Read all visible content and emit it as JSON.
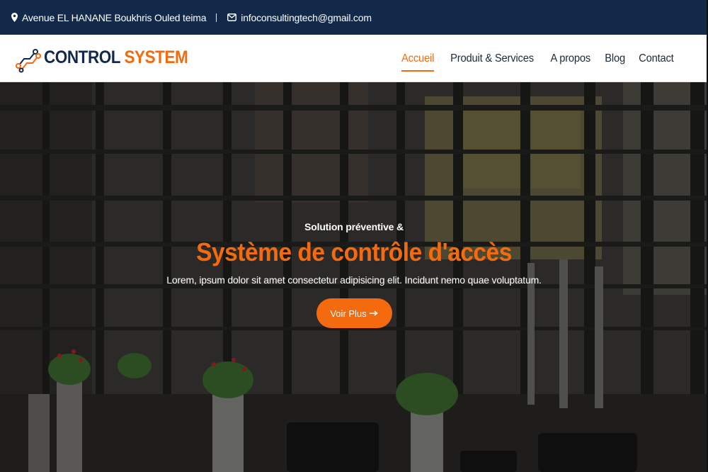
{
  "topbar": {
    "address": "Avenue EL HANANE Boukhris Ouled teima",
    "email": "infoconsultingtech@gmail.com",
    "address_icon": "map-marker-icon",
    "email_icon": "envelope-icon"
  },
  "brand": {
    "word1": "CONTROL",
    "word2": "SYSTEM",
    "logo_icon": "circuit-nodes-icon"
  },
  "nav": {
    "items": [
      {
        "label": "Accueil",
        "active": true
      },
      {
        "label": "Produit & Services",
        "active": false
      },
      {
        "label": "A propos",
        "active": false
      },
      {
        "label": "Blog",
        "active": false
      },
      {
        "label": "Contact",
        "active": false
      }
    ]
  },
  "hero": {
    "kicker": "Solution préventive &",
    "title": "Système de contrôle d'accès",
    "description": "Lorem, ipsum dolor sit amet consectetur adipisicing elit. Incidunt nemo quae voluptatum.",
    "button_label": "Voir Plus",
    "button_icon": "arrow-right-icon"
  },
  "colors": {
    "topbar_bg": "#12294a",
    "accent": "#f46a0f",
    "brand_dark": "#12294a",
    "nav_text": "#1b2a3a"
  }
}
